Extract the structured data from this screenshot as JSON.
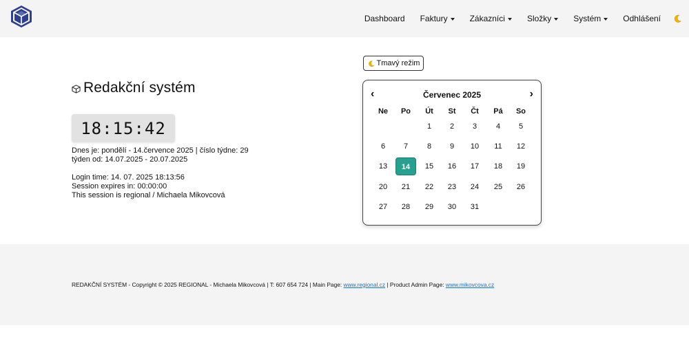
{
  "nav": {
    "dashboard": "Dashboard",
    "faktury": "Faktury",
    "zakaznici": "Zákazníci",
    "slozky": "Složky",
    "system": "Systém",
    "logout": "Odhlášení",
    "theme_icon": "moon-icon"
  },
  "main": {
    "title": "Redakční systém",
    "clock": "18:15:42",
    "date_line": "Dnes je: pondělí - 14.července 2025 | číslo týdne: 29",
    "week_line": "týden od: 14.07.2025 - 20.07.2025",
    "login_time": "Login time: 14. 07. 2025 18:13:56",
    "session_expires": "Session expires in: 00:00:00",
    "session_regional": "This session is regional / Michaela Mikovcová"
  },
  "dark_mode_button": "Tmavý režim",
  "calendar": {
    "month": "Červenec 2025",
    "prev": "‹",
    "next": "›",
    "weekdays": [
      "Ne",
      "Po",
      "Út",
      "St",
      "Čt",
      "Pá",
      "So"
    ],
    "first_weekday_index": 2,
    "days_in_month": 31,
    "today": 14
  },
  "footer": {
    "text": "REDAKČNÍ SYSTÉM - Copyright © 2025 REGIONAL - Michaela Mikovcová | T: 607 654 724 | Main Page: ",
    "main_link": "www.regional.cz",
    "middle": " | Product Admin Page: ",
    "admin_link": "www.mikovcova.cz"
  },
  "colors": {
    "accent": "#26a08f",
    "link": "#1a73c9",
    "logo": "#2f3f8f"
  }
}
